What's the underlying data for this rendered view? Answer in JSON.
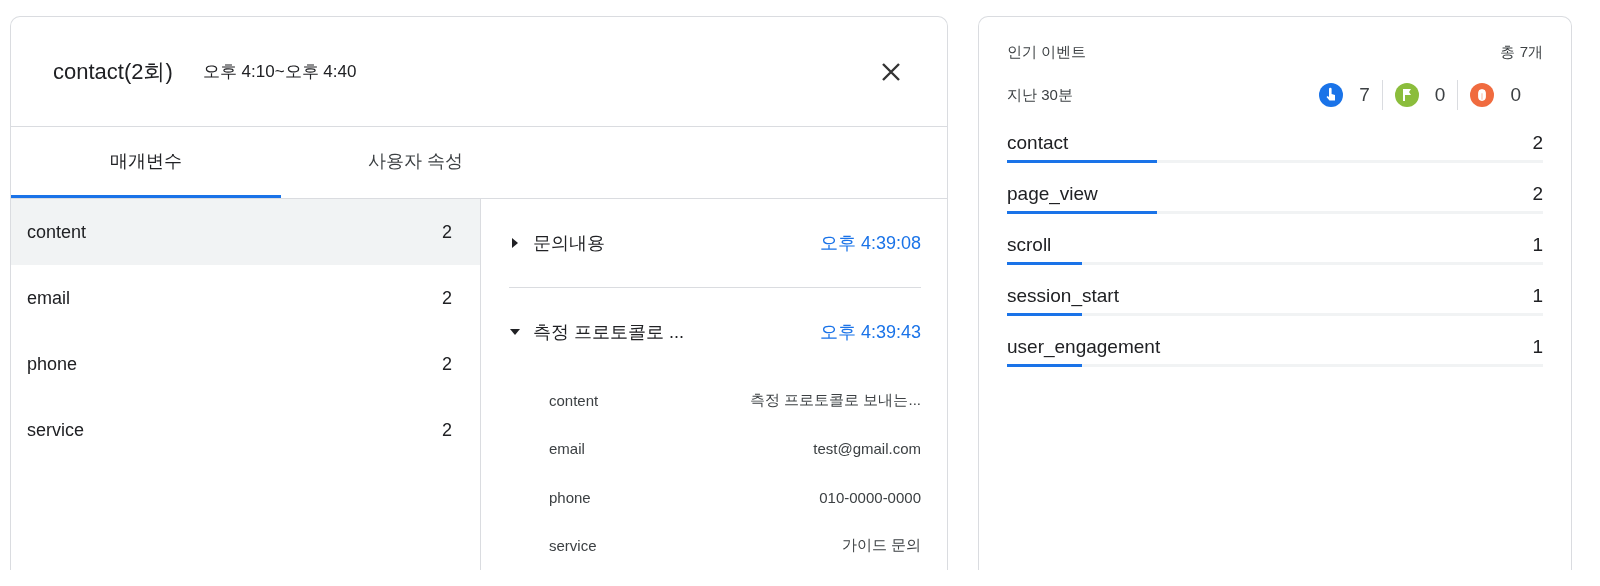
{
  "detail": {
    "title": "contact(2회)",
    "time_range": "오후 4:10~오후 4:40",
    "tabs": [
      {
        "label": "매개변수",
        "selected": true
      },
      {
        "label": "사용자 속성",
        "selected": false
      }
    ],
    "params": [
      {
        "name": "content",
        "count": "2",
        "selected": true
      },
      {
        "name": "email",
        "count": "2",
        "selected": false
      },
      {
        "name": "phone",
        "count": "2",
        "selected": false
      },
      {
        "name": "service",
        "count": "2",
        "selected": false
      }
    ],
    "events": [
      {
        "label": "문의내용",
        "time": "오후 4:39:08",
        "expanded": false
      },
      {
        "label": "측정 프로토콜로 ...",
        "time": "오후 4:39:43",
        "expanded": true,
        "values": [
          {
            "key": "content",
            "value": "측정 프로토콜로 보내는..."
          },
          {
            "key": "email",
            "value": "test@gmail.com"
          },
          {
            "key": "phone",
            "value": "010-0000-0000"
          },
          {
            "key": "service",
            "value": "가이드 문의"
          }
        ]
      }
    ]
  },
  "popular": {
    "title": "인기 이벤트",
    "total": "총 7개",
    "period": "지난 30분",
    "stats": [
      {
        "kind": "touch",
        "count": "7",
        "color": "#1a73e8"
      },
      {
        "kind": "flag",
        "count": "0",
        "color": "#8bbd3c"
      },
      {
        "kind": "bug",
        "count": "0",
        "color": "#f06b3f"
      }
    ],
    "events": [
      {
        "name": "contact",
        "count": "2",
        "level": 0.28
      },
      {
        "name": "page_view",
        "count": "2",
        "level": 0.28
      },
      {
        "name": "scroll",
        "count": "1",
        "level": 0.14
      },
      {
        "name": "session_start",
        "count": "1",
        "level": 0.14
      },
      {
        "name": "user_engagement",
        "count": "1",
        "level": 0.14
      }
    ]
  }
}
